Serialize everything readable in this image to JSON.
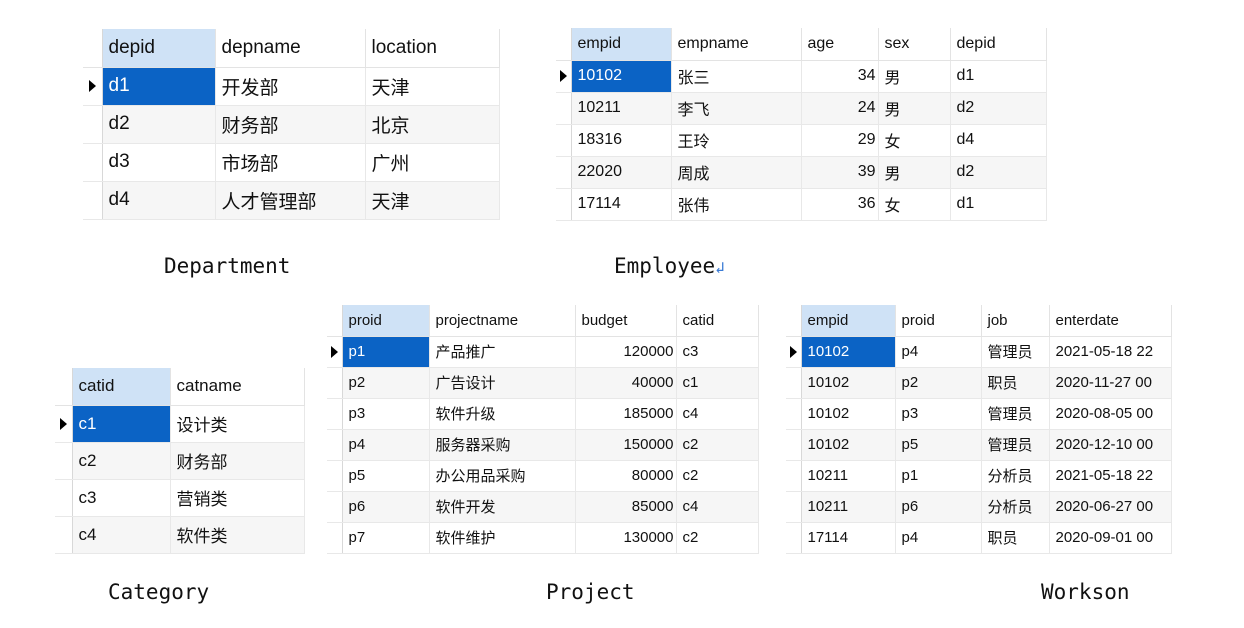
{
  "captions": {
    "department": "Department",
    "employee": "Employee",
    "category": "Category",
    "project": "Project",
    "workson": "Workson"
  },
  "department": {
    "columns": [
      "depid",
      "depname",
      "location"
    ],
    "rows": [
      [
        "d1",
        "开发部",
        "天津"
      ],
      [
        "d2",
        "财务部",
        "北京"
      ],
      [
        "d3",
        "市场部",
        "广州"
      ],
      [
        "d4",
        "人才管理部",
        "天津"
      ]
    ]
  },
  "employee": {
    "columns": [
      "empid",
      "empname",
      "age",
      "sex",
      "depid"
    ],
    "rows": [
      [
        "10102",
        "张三",
        "34",
        "男",
        "d1"
      ],
      [
        "10211",
        "李飞",
        "24",
        "男",
        "d2"
      ],
      [
        "18316",
        "王玲",
        "29",
        "女",
        "d4"
      ],
      [
        "22020",
        "周成",
        "39",
        "男",
        "d2"
      ],
      [
        "17114",
        "张伟",
        "36",
        "女",
        "d1"
      ]
    ]
  },
  "category": {
    "columns": [
      "catid",
      "catname"
    ],
    "rows": [
      [
        "c1",
        "设计类"
      ],
      [
        "c2",
        "财务部"
      ],
      [
        "c3",
        "营销类"
      ],
      [
        "c4",
        "软件类"
      ]
    ]
  },
  "project": {
    "columns": [
      "proid",
      "projectname",
      "budget",
      "catid"
    ],
    "rows": [
      [
        "p1",
        "产品推广",
        "120000",
        "c3"
      ],
      [
        "p2",
        "广告设计",
        "40000",
        "c1"
      ],
      [
        "p3",
        "软件升级",
        "185000",
        "c4"
      ],
      [
        "p4",
        "服务器采购",
        "150000",
        "c2"
      ],
      [
        "p5",
        "办公用品采购",
        "80000",
        "c2"
      ],
      [
        "p6",
        "软件开发",
        "85000",
        "c4"
      ],
      [
        "p7",
        "软件维护",
        "130000",
        "c2"
      ]
    ]
  },
  "workson": {
    "columns": [
      "empid",
      "proid",
      "job",
      "enterdate"
    ],
    "rows": [
      [
        "10102",
        "p4",
        "管理员",
        "2021-05-18 22"
      ],
      [
        "10102",
        "p2",
        "职员",
        "2020-11-27 00"
      ],
      [
        "10102",
        "p3",
        "管理员",
        "2020-08-05 00"
      ],
      [
        "10102",
        "p5",
        "管理员",
        "2020-12-10 00"
      ],
      [
        "10211",
        "p1",
        "分析员",
        "2021-05-18 22"
      ],
      [
        "10211",
        "p6",
        "分析员",
        "2020-06-27 00"
      ],
      [
        "17114",
        "p4",
        "职员",
        "2020-09-01 00"
      ]
    ]
  }
}
